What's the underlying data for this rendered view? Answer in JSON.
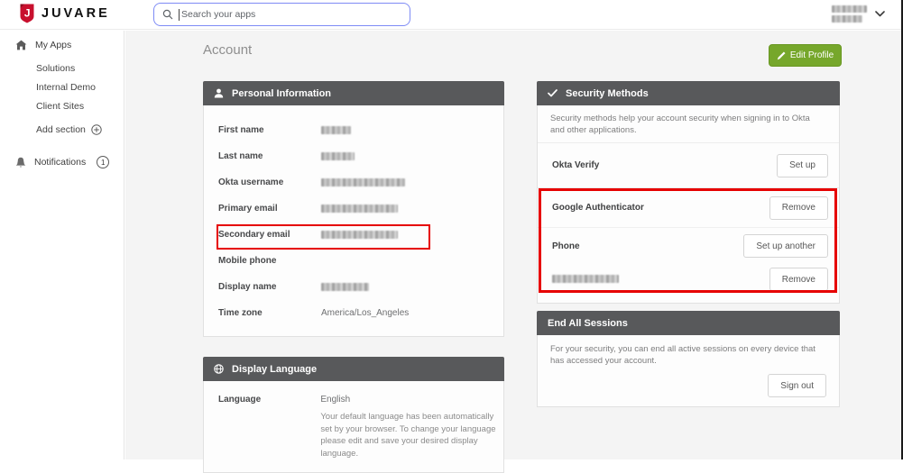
{
  "topbar": {
    "logo": "JUVARE",
    "search_placeholder": "Search your apps",
    "user": {
      "name_redacted": true
    }
  },
  "sidebar": {
    "items": [
      {
        "label": "My Apps"
      },
      {
        "label": "Solutions"
      },
      {
        "label": "Internal Demo"
      },
      {
        "label": "Client Sites"
      },
      {
        "label": "Add section"
      }
    ],
    "notifications": {
      "label": "Notifications",
      "badge": "1"
    }
  },
  "page": {
    "title": "Account",
    "edit_profile": "Edit Profile"
  },
  "personal_information": {
    "title": "Personal Information",
    "fields": [
      {
        "label": "First name",
        "value": "",
        "redacted": true
      },
      {
        "label": "Last name",
        "value": "",
        "redacted": true
      },
      {
        "label": "Okta username",
        "value": "",
        "redacted": true
      },
      {
        "label": "Primary email",
        "value": "",
        "redacted": true
      },
      {
        "label": "Secondary email",
        "value": "",
        "redacted": true,
        "annotated": true
      },
      {
        "label": "Mobile phone",
        "value": "",
        "redacted": false
      },
      {
        "label": "Display name",
        "value": "",
        "redacted": true
      },
      {
        "label": "Time zone",
        "value": "America/Los_Angeles",
        "redacted": false
      }
    ]
  },
  "display_language": {
    "title": "Display Language",
    "language_label": "Language",
    "language_value": "English",
    "description": "Your default language has been automatically set by your browser. To change your language please edit and save your desired display language."
  },
  "security_methods": {
    "title": "Security Methods",
    "description": "Security methods help your account security when signing in to Okta and other applications.",
    "okta_verify": {
      "label": "Okta Verify",
      "button": "Set up"
    },
    "google_authenticator": {
      "label": "Google Authenticator",
      "button": "Remove",
      "annotated": true
    },
    "phone": {
      "label": "Phone",
      "setup_button": "Set up another",
      "remove_button": "Remove",
      "number_redacted": true,
      "annotated": true
    }
  },
  "end_all_sessions": {
    "title": "End All Sessions",
    "description": "For your security, you can end all active sessions on every device that has accessed your account.",
    "button": "Sign out"
  },
  "colors": {
    "brand_red": "#c8102e",
    "edit_profile_green": "#76a72b",
    "card_header_gray": "#58595b",
    "annotation_red": "#e60000",
    "search_focus_blue": "#7e8bf5"
  }
}
